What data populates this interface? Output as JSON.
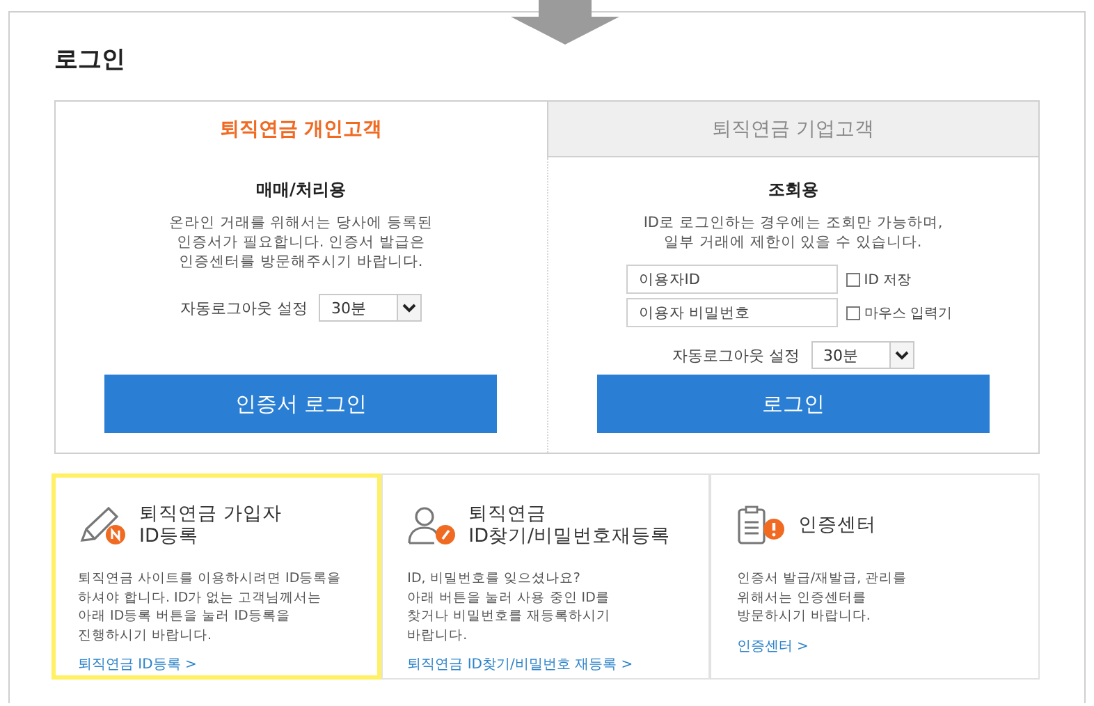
{
  "page_title": "로그인",
  "tabs": [
    {
      "label": "퇴직연금 개인고객",
      "selected": true
    },
    {
      "label": "퇴직연금 기업고객",
      "selected": false
    }
  ],
  "panels": [
    {
      "kind": "certificate",
      "heading": "매매/처리용",
      "description_lines": [
        "온라인 거래를 위해서는 당사에 등록된",
        "인증서가 필요합니다. 인증서 발급은",
        "인증센터를 방문해주시기 바랍니다."
      ],
      "auto_logout": {
        "label": "자동로그아웃 설정",
        "value": "30분"
      },
      "button": "인증서 로그인"
    },
    {
      "kind": "id",
      "heading": "조회용",
      "description_lines": [
        "ID로 로그인하는 경우에는 조회만 가능하며,",
        "일부 거래에 제한이 있을 수 있습니다."
      ],
      "fields": [
        {
          "placeholder": "이용자ID",
          "option": {
            "label": "ID 저장",
            "checked": false
          }
        },
        {
          "placeholder": "이용자 비밀번호",
          "option": {
            "label": "마우스 입력기",
            "checked": false
          }
        }
      ],
      "auto_logout": {
        "label": "자동로그아웃 설정",
        "value": "30분"
      },
      "button": "로그인"
    }
  ],
  "cards": [
    {
      "kind": "pencil",
      "highlighted": true,
      "title_lines": [
        "퇴직연금 가입자",
        "ID등록"
      ],
      "description_lines": [
        "퇴직연금 사이트를 이용하시려면 ID등록을",
        "하셔야 합니다. ID가 없는 고객님께서는",
        "아래 ID등록 버튼을 눌러 ID등록을",
        "진행하시기 바랍니다."
      ],
      "link": "퇴직연금 ID등록 >"
    },
    {
      "kind": "person",
      "highlighted": false,
      "title_lines": [
        "퇴직연금",
        "ID찾기/비밀번호재등록"
      ],
      "description_lines": [
        "ID, 비밀번호를 잊으셨나요?",
        "아래 버튼을 눌러 사용 중인 ID를",
        "찾거나 비밀번호를 재등록하시기",
        "바랍니다."
      ],
      "link": "퇴직연금 ID찾기/비밀번호 재등록 >"
    },
    {
      "kind": "clipboard",
      "highlighted": false,
      "title_lines": [
        "인증센터"
      ],
      "description_lines": [
        "인증서 발급/재발급, 관리를",
        "위해서는 인증센터를",
        "방문하시기 바랍니다."
      ],
      "link": "인증센터 >"
    }
  ]
}
